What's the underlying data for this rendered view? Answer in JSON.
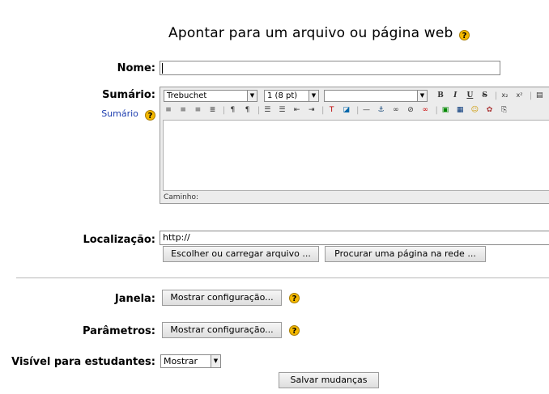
{
  "page_title": "Apontar para um arquivo ou página web",
  "name_field": {
    "label": "Nome:",
    "value": ""
  },
  "summary": {
    "label": "Sumário:",
    "help_link": "Sumário",
    "font_family": "Trebuchet",
    "font_size": "1 (8 pt)",
    "format": "",
    "path_label": "Caminho:"
  },
  "location": {
    "label": "Localização:",
    "value": "http://",
    "choose_button": "Escolher ou carregar arquivo ...",
    "search_button": "Procurar uma página na rede ..."
  },
  "window": {
    "label": "Janela:",
    "button": "Mostrar configuração..."
  },
  "parameters": {
    "label": "Parâmetros:",
    "button": "Mostrar configuração..."
  },
  "visible": {
    "label": "Visível para estudantes:",
    "value": "Mostrar"
  },
  "save_button": "Salvar mudanças",
  "help_glyph": "?"
}
